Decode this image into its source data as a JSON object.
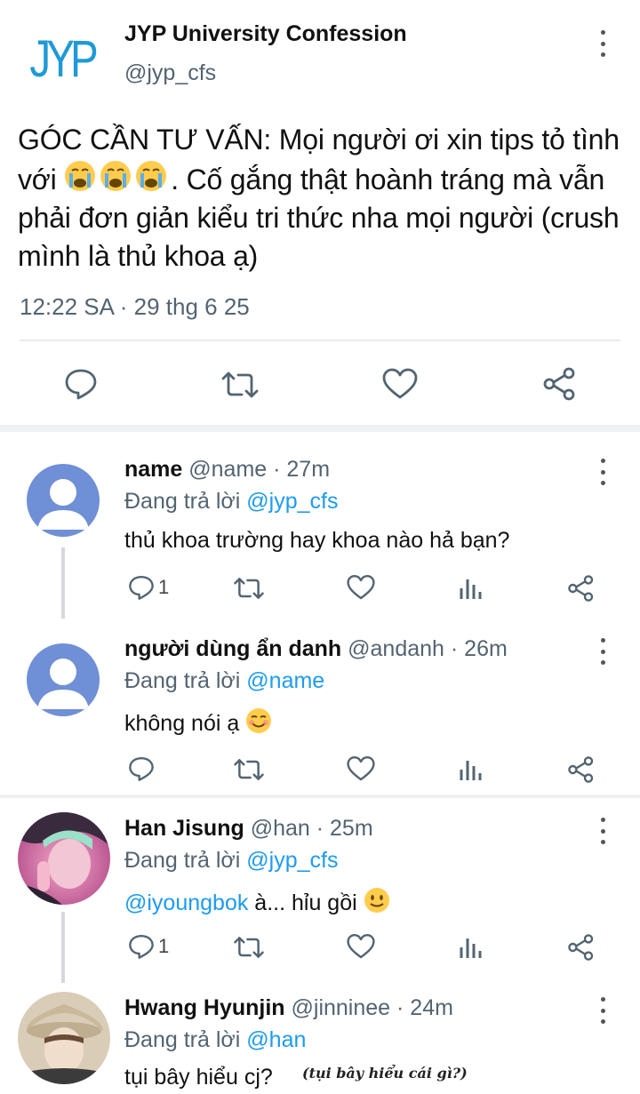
{
  "main_tweet": {
    "author_name": "JYP University Confession",
    "author_handle": "@jyp_cfs",
    "logo_text": "JYP",
    "text_before_emoji": "GÓC CẦN TƯ VẤN: Mọi người ơi xin tips tỏ tình với ",
    "text_after_emoji": ". Cố gắng thật hoành tráng mà vẫn phải đơn giản kiểu tri thức nha mọi người (crush mình là thủ khoa ạ)",
    "emoji": "loudly-crying-face x3",
    "timestamp": "12:22 SA · 29 thg 6 25",
    "icons": [
      "reply-icon",
      "retweet-icon",
      "like-icon",
      "share-icon"
    ]
  },
  "replies": [
    {
      "name": "name",
      "meta": "@name · 27m",
      "replying_prefix": "Đang trả lời ",
      "replying_to": "@jyp_cfs",
      "text": "thủ khoa trường hay khoa nào hả bạn?",
      "reply_count": "1",
      "avatar": "default"
    },
    {
      "name": "người dùng ẩn danh",
      "meta": "@andanh · 26m",
      "replying_prefix": "Đang trả lời ",
      "replying_to": "@name",
      "text": "không nói ạ",
      "reply_count": "",
      "avatar": "default"
    },
    {
      "name": "Han Jisung",
      "meta": "@han · 25m",
      "replying_prefix": "Đang trả lời ",
      "replying_to": "@jyp_cfs",
      "text_mention": "@iyoungbok",
      "text": " à... hỉu gồi",
      "reply_count": "1",
      "avatar": "photo-pink"
    },
    {
      "name": "Hwang Hyunjin",
      "meta": "@jinninee · 24m",
      "replying_prefix": "Đang trả lời ",
      "replying_to": "@han",
      "text": "tụi bây hiểu cj?",
      "avatar": "photo-beige"
    }
  ],
  "annotation": "(tụi bây hiểu cái gì?)",
  "colors": {
    "accent": "#1d9bf0",
    "secondary_text": "#536471",
    "logo": "#1f9ad6",
    "avatar_default": "#6f8fd6"
  }
}
